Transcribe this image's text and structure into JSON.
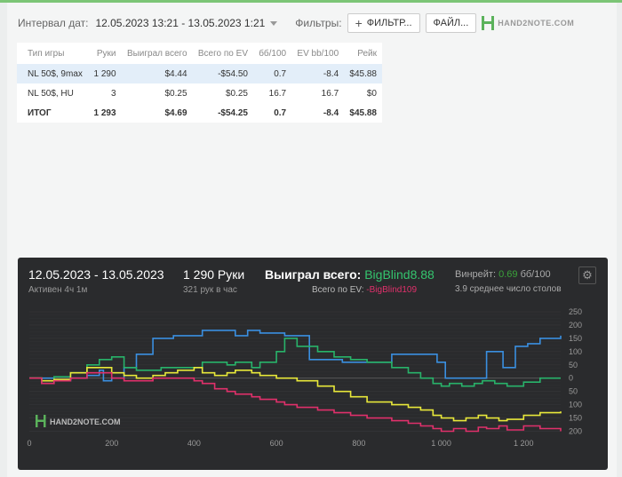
{
  "filter": {
    "interval_label": "Интервал дат:",
    "interval_value": "12.05.2023 13:21 - 13.05.2023 1:21",
    "filters_label": "Фильтры:",
    "filter_button": "ФИЛЬТР...",
    "file_button": "ФАЙЛ...",
    "logo_text": "HAND2NOTE.COM"
  },
  "table": {
    "headers": [
      "Тип игры",
      "Руки",
      "Выиграл всего",
      "Всего по EV",
      "бб/100",
      "EV bb/100",
      "Рейк"
    ],
    "rows": [
      [
        "NL 50$, 9max",
        "1 290",
        "$4.44",
        "-$54.50",
        "0.7",
        "-8.4",
        "$45.88"
      ],
      [
        "NL 50$, HU",
        "3",
        "$0.25",
        "$0.25",
        "16.7",
        "16.7",
        "$0"
      ],
      [
        "ИТОГ",
        "1 293",
        "$4.69",
        "-$54.25",
        "0.7",
        "-8.4",
        "$45.88"
      ]
    ]
  },
  "summary": {
    "date_range": "12.05.2023 - 13.05.2023",
    "active": "Активен 4ч 1м",
    "hands": "1 290 Руки",
    "hands_per_hour": "321 рук в час",
    "won_label": "Выиграл всего:",
    "won_value": "BigBlind8.88",
    "ev_label": "Всего по EV:",
    "ev_value": "-BigBlind109",
    "winrate_label": "Винрейт:",
    "winrate_value": "0.69",
    "winrate_unit": "бб/100",
    "tables_avg": "3.9 среднее число столов",
    "logo_text": "HAND2NOTE.COM"
  },
  "colors": {
    "accent_green": "#7cc576",
    "positive": "#3aa33a",
    "negative": "#d9331a",
    "chart_bg": "#2a2b2d",
    "won_line": "#28b36a",
    "ev_line": "#e0306b",
    "showdown_line": "#e8e83a",
    "nonshowdown_line": "#3a8fe0"
  },
  "chart_data": {
    "type": "line",
    "x_ticks": [
      "0",
      "200",
      "400",
      "600",
      "800",
      "1 000",
      "1 200"
    ],
    "xlim": [
      0,
      1290
    ],
    "right_ticks_top": [
      "250",
      "200",
      "150",
      "100",
      "50",
      "0"
    ],
    "right_ticks_bottom": [
      "50",
      "100",
      "150",
      "200"
    ],
    "ylim": [
      -215,
      260
    ],
    "grid": true,
    "series": [
      {
        "color": "#3a8fe0",
        "x": [
          0,
          30,
          60,
          100,
          140,
          170,
          180,
          200,
          230,
          260,
          300,
          330,
          350,
          400,
          420,
          450,
          480,
          500,
          530,
          560,
          620,
          680,
          760,
          880,
          950,
          990,
          1010,
          1050,
          1080,
          1110,
          1150,
          1180,
          1210,
          1240,
          1290
        ],
        "y": [
          0,
          0,
          -10,
          0,
          10,
          30,
          -10,
          0,
          40,
          90,
          150,
          150,
          160,
          160,
          180,
          180,
          180,
          160,
          180,
          170,
          160,
          70,
          60,
          90,
          90,
          60,
          0,
          0,
          0,
          100,
          40,
          120,
          130,
          150,
          160
        ]
      },
      {
        "color": "#28b36a",
        "x": [
          0,
          30,
          60,
          100,
          140,
          170,
          200,
          230,
          260,
          280,
          320,
          360,
          400,
          420,
          450,
          480,
          500,
          540,
          560,
          600,
          620,
          650,
          700,
          740,
          780,
          820,
          880,
          920,
          950,
          980,
          1000,
          1020,
          1050,
          1080,
          1100,
          1130,
          1160,
          1200,
          1240,
          1290
        ],
        "y": [
          0,
          -20,
          5,
          20,
          50,
          70,
          80,
          40,
          30,
          30,
          40,
          40,
          40,
          60,
          60,
          50,
          60,
          40,
          60,
          100,
          150,
          120,
          100,
          80,
          70,
          60,
          40,
          20,
          0,
          -20,
          -30,
          -20,
          -30,
          -20,
          -10,
          -20,
          -30,
          -15,
          0,
          0
        ]
      },
      {
        "color": "#e8e83a",
        "x": [
          0,
          30,
          60,
          100,
          140,
          170,
          200,
          230,
          260,
          300,
          330,
          360,
          400,
          420,
          450,
          480,
          500,
          540,
          560,
          600,
          620,
          650,
          700,
          740,
          780,
          820,
          880,
          920,
          950,
          980,
          1000,
          1030,
          1060,
          1090,
          1110,
          1140,
          1160,
          1200,
          1240,
          1290
        ],
        "y": [
          0,
          -10,
          -5,
          20,
          40,
          40,
          20,
          10,
          0,
          10,
          20,
          30,
          40,
          20,
          10,
          20,
          30,
          20,
          10,
          0,
          0,
          -10,
          -30,
          -50,
          -70,
          -90,
          -100,
          -110,
          -120,
          -140,
          -150,
          -160,
          -150,
          -140,
          -150,
          -160,
          -155,
          -140,
          -130,
          -125
        ]
      },
      {
        "color": "#e0306b",
        "x": [
          0,
          30,
          60,
          100,
          140,
          170,
          200,
          230,
          260,
          300,
          330,
          360,
          400,
          420,
          450,
          480,
          500,
          540,
          560,
          600,
          620,
          650,
          700,
          740,
          780,
          820,
          880,
          920,
          950,
          980,
          1000,
          1030,
          1060,
          1090,
          1110,
          1140,
          1160,
          1200,
          1240,
          1290
        ],
        "y": [
          0,
          -20,
          -10,
          0,
          20,
          20,
          0,
          -10,
          -10,
          0,
          0,
          0,
          -10,
          -20,
          -40,
          -50,
          -60,
          -70,
          -80,
          -90,
          -100,
          -110,
          -120,
          -130,
          -140,
          -150,
          -160,
          -170,
          -180,
          -190,
          -200,
          -190,
          -200,
          -185,
          -190,
          -180,
          -195,
          -180,
          -190,
          -200
        ]
      }
    ]
  }
}
